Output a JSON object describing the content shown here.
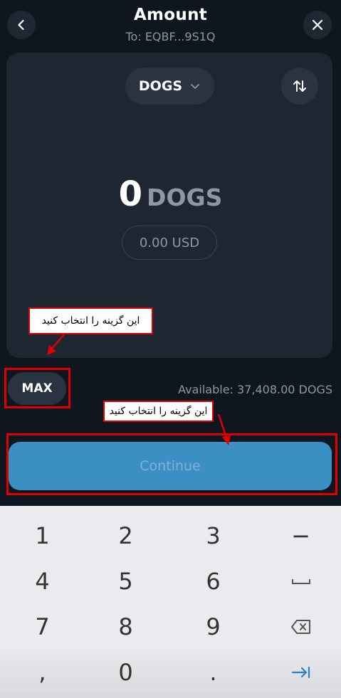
{
  "header": {
    "title": "Amount",
    "subtitle": "To: EQBF...9S1Q",
    "back_icon": "chevron-left-icon",
    "close_icon": "close-icon"
  },
  "card": {
    "token_label": "DOGS",
    "amount_value": "0",
    "amount_unit": "DOGS",
    "usd_value": "0.00 USD"
  },
  "max_label": "MAX",
  "available_text": "Available: 37,408.00 DOGS",
  "continue_label": "Continue",
  "annotations": {
    "label_1": "این گزینه را انتخاب کنید",
    "label_2": "این گزینه را انتخاب کنید",
    "color": "#e00000"
  },
  "keyboard": {
    "rows": [
      [
        "1",
        "2",
        "3",
        "−"
      ],
      [
        "4",
        "5",
        "6",
        "␣"
      ],
      [
        "7",
        "8",
        "9",
        "⌫"
      ],
      [
        ",",
        "0",
        ".",
        "→|"
      ]
    ]
  },
  "colors": {
    "background": "#10161f",
    "card": "#1d2631",
    "accent": "#3b8fc2"
  }
}
